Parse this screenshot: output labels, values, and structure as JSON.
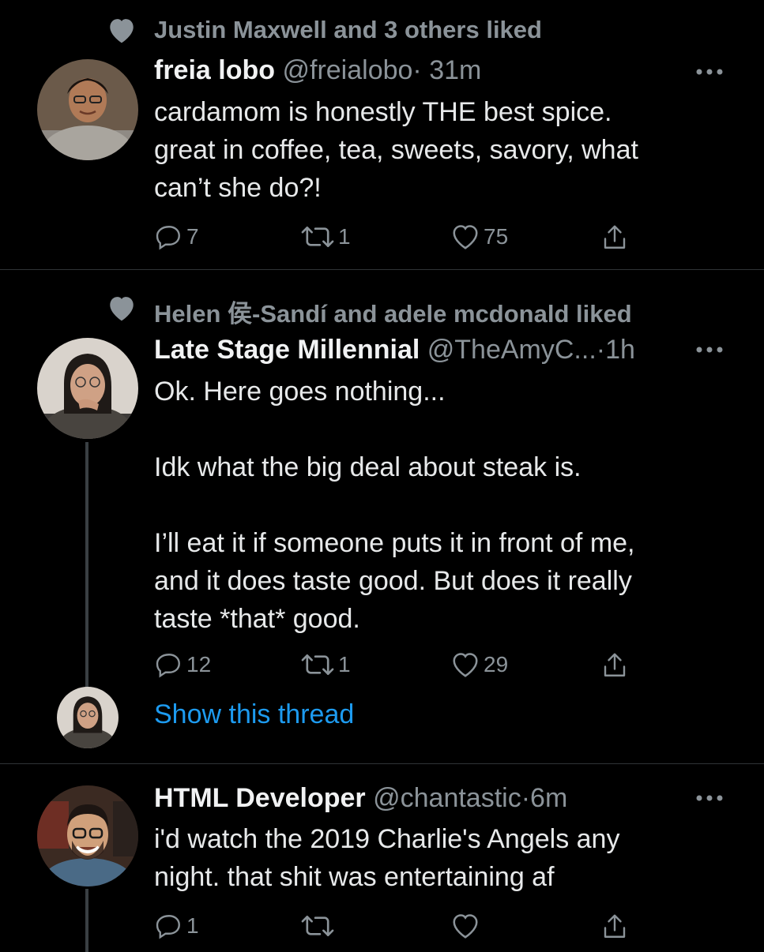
{
  "tweets": [
    {
      "social": "Justin Maxwell and 3 others liked",
      "name": "freia lobo",
      "handle": "@freialobo",
      "dot": "·",
      "time": "31m",
      "text": "cardamom is honestly THE best spice.\ngreat in coffee, tea, sweets, savory, what\ncan’t she do?!",
      "replies": "7",
      "retweets": "1",
      "likes": "75"
    },
    {
      "social": "Helen 侯-Sandí and adele mcdonald liked",
      "name": "Late Stage Millennial",
      "handle": "@TheAmyC...",
      "dot": "·",
      "time": "1h",
      "text": "Ok. Here goes nothing...\n\nIdk what the big deal about steak is.\n\nI’ll eat it if someone puts it in front of me,\nand it does taste good. But does it really\ntaste *that* good.",
      "replies": "12",
      "retweets": "1",
      "likes": "29",
      "show_thread": "Show this thread"
    },
    {
      "name": "HTML Developer",
      "handle": "@chantastic",
      "dot": "·",
      "time": "6m",
      "text": "i'd watch the 2019 Charlie's Angels any\nnight. that shit was entertaining af",
      "replies": "1",
      "retweets": "",
      "likes": ""
    }
  ],
  "icons": {
    "social_like": "heart-icon",
    "more": "more-horizontal-icon",
    "reply": "reply-icon",
    "retweet": "retweet-icon",
    "like": "heart-outline-icon",
    "share": "share-icon"
  },
  "colors": {
    "background": "#000000",
    "text": "#e7e9ea",
    "muted": "#8b9399",
    "link": "#1d9bf0"
  }
}
